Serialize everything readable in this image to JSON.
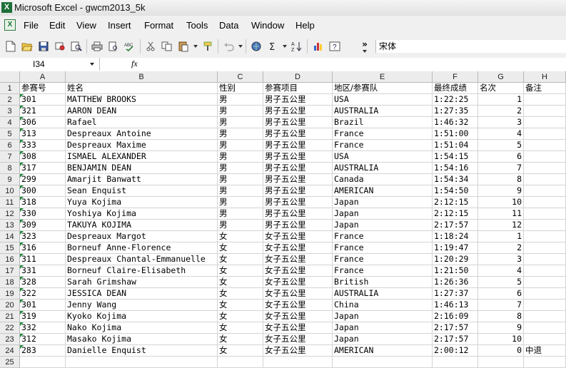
{
  "window": {
    "title": "Microsoft Excel - gwcm2013_5k"
  },
  "menu": [
    "File",
    "Edit",
    "View",
    "Insert",
    "Format",
    "Tools",
    "Data",
    "Window",
    "Help"
  ],
  "toolbar": {
    "font_name": "宋体",
    "more_glyph": "»"
  },
  "formula_bar": {
    "name_box": "I34",
    "fx_label": "fx",
    "formula": ""
  },
  "columns": [
    "A",
    "B",
    "C",
    "D",
    "E",
    "F",
    "G",
    "H"
  ],
  "header_row": [
    "参赛号",
    "姓名",
    "性别",
    "参赛项目",
    "地区/参赛队",
    "最终成绩",
    "名次",
    "备注"
  ],
  "rows": [
    [
      "301",
      "MATTHEW BROOKS",
      "男",
      "男子五公里",
      "USA",
      "1:22:25",
      "1",
      ""
    ],
    [
      "321",
      "AARON DEAN",
      "男",
      "男子五公里",
      "AUSTRALIA",
      "1:27:35",
      "2",
      ""
    ],
    [
      "306",
      "Rafael",
      "男",
      "男子五公里",
      "Brazil",
      "1:46:32",
      "3",
      ""
    ],
    [
      "313",
      "Despreaux Antoine",
      "男",
      "男子五公里",
      "France",
      "1:51:00",
      "4",
      ""
    ],
    [
      "333",
      "Despreaux Maxime",
      "男",
      "男子五公里",
      "France",
      "1:51:04",
      "5",
      ""
    ],
    [
      "308",
      "ISMAEL ALEXANDER",
      "男",
      "男子五公里",
      "USA",
      "1:54:15",
      "6",
      ""
    ],
    [
      "317",
      "BENJAMIN DEAN",
      "男",
      "男子五公里",
      "AUSTRALIA",
      "1:54:16",
      "7",
      ""
    ],
    [
      "299",
      "Amarjit Banwatt",
      "男",
      "男子五公里",
      "Canada",
      "1:54:34",
      "8",
      ""
    ],
    [
      "300",
      "Sean Enquist",
      "男",
      "男子五公里",
      "AMERICAN",
      "1:54:50",
      "9",
      ""
    ],
    [
      "318",
      "Yuya Kojima",
      "男",
      "男子五公里",
      "Japan",
      "2:12:15",
      "10",
      ""
    ],
    [
      "330",
      "Yoshiya Kojima",
      "男",
      "男子五公里",
      "Japan",
      "2:12:15",
      "11",
      ""
    ],
    [
      "309",
      "TAKUYA KOJIMA",
      "男",
      "男子五公里",
      "Japan",
      "2:17:57",
      "12",
      ""
    ],
    [
      "323",
      "Despreaux Margot",
      "女",
      "女子五公里",
      "France",
      "1:18:24",
      "1",
      ""
    ],
    [
      "316",
      "Borneuf Anne-Florence",
      "女",
      "女子五公里",
      "France",
      "1:19:47",
      "2",
      ""
    ],
    [
      "311",
      "Despreaux Chantal-Emmanuelle",
      "女",
      "女子五公里",
      "France",
      "1:20:29",
      "3",
      ""
    ],
    [
      "331",
      "Borneuf Claire-Elisabeth",
      "女",
      "女子五公里",
      "France",
      "1:21:50",
      "4",
      ""
    ],
    [
      "328",
      "Sarah Grimshaw",
      "女",
      "女子五公里",
      "British",
      "1:26:36",
      "5",
      ""
    ],
    [
      "322",
      "JESSICA DEAN",
      "女",
      "女子五公里",
      "AUSTRALIA",
      "1:27:37",
      "6",
      ""
    ],
    [
      "301",
      "Jenny Wang",
      "女",
      "女子五公里",
      "China",
      "1:46:13",
      "7",
      ""
    ],
    [
      "319",
      "Kyoko Kojima",
      "女",
      "女子五公里",
      "Japan",
      "2:16:09",
      "8",
      ""
    ],
    [
      "332",
      "Nako Kojima",
      "女",
      "女子五公里",
      "Japan",
      "2:17:57",
      "9",
      ""
    ],
    [
      "312",
      "Masako Kojima",
      "女",
      "女子五公里",
      "Japan",
      "2:17:57",
      "10",
      ""
    ],
    [
      "283",
      "Danielle Enquist",
      "女",
      "女子五公里",
      "AMERICAN",
      "2:00:12",
      "0",
      "中退"
    ],
    [
      "",
      "",
      "",
      "",
      "",
      "",
      "",
      ""
    ]
  ],
  "colors": {
    "excel_green": "#1d6f3a",
    "number_stored_as_text_marker": "#1e8b3a"
  }
}
